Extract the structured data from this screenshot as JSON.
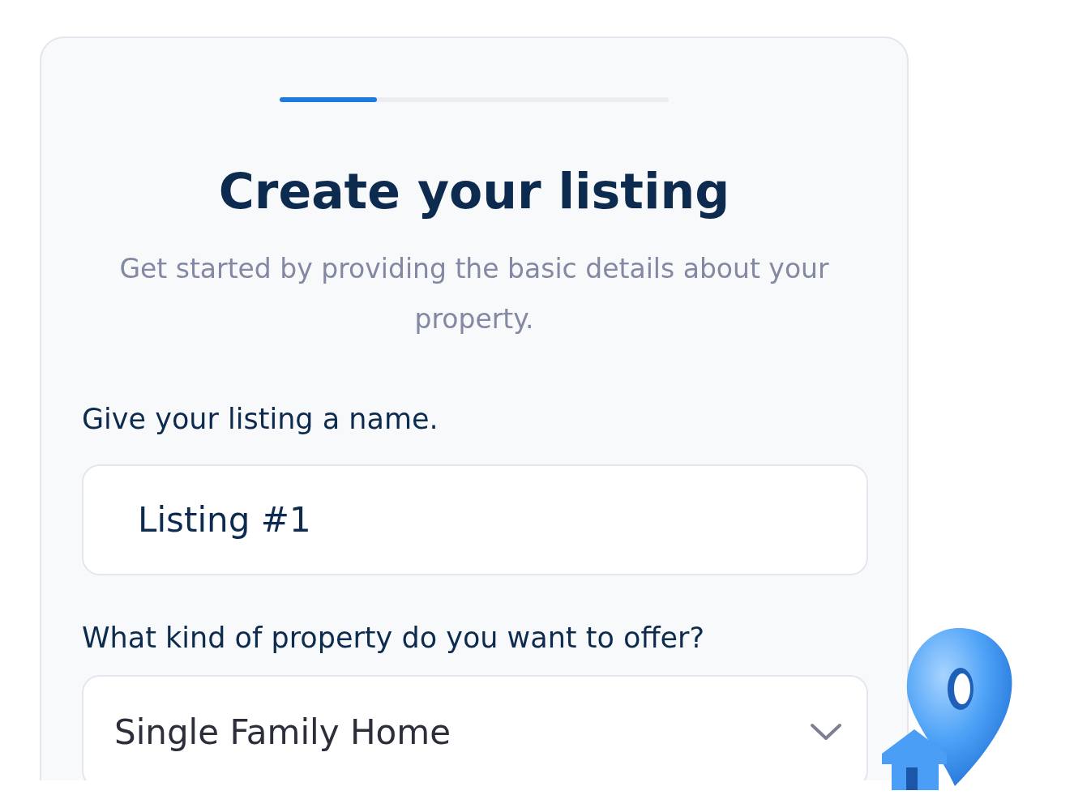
{
  "progress": {
    "level": 0.25
  },
  "title": "Create your listing",
  "subtitle": "Get started by providing the basic details about your property.",
  "fields": [
    {
      "kind": "text",
      "label": "Give your listing a name.",
      "value": "Listing #1"
    },
    {
      "kind": "select",
      "label": "What kind of property do you want to offer?",
      "value": "Single Family Home"
    }
  ]
}
